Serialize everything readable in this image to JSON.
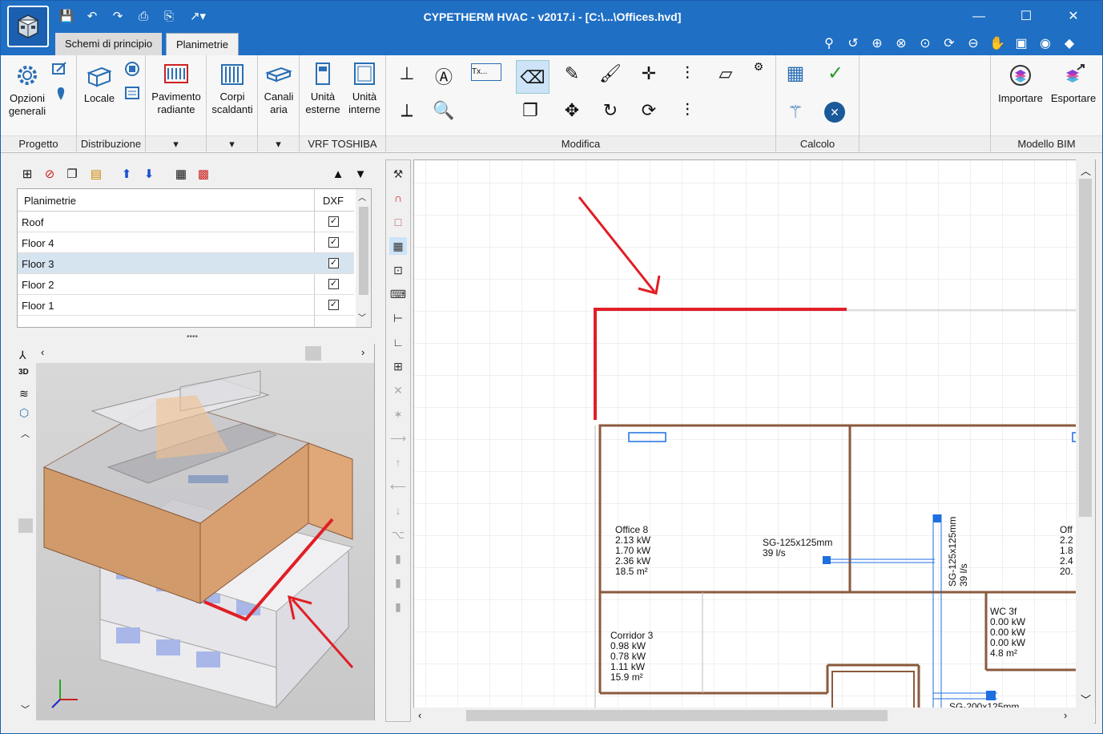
{
  "title": "CYPETHERM HVAC - v2017.i - [C:\\...\\Offices.hvd]",
  "tabs": [
    "Schemi di principio",
    "Planimetrie"
  ],
  "ribbon": {
    "opzioni": "Opzioni\ngenerali",
    "locale": "Locale",
    "pavimento": "Pavimento\nradiante",
    "corpi": "Corpi\nscaldanti",
    "canali": "Canali\naria",
    "esterne": "Unità\nesterne",
    "interne": "Unità\ninterne",
    "importare": "Importare",
    "esportare": "Esportare",
    "groups": {
      "progetto": "Progetto",
      "distribuzione": "Distribuzione",
      "vrf": "VRF TOSHIBA",
      "modifica": "Modifica",
      "calcolo": "Calcolo",
      "bim": "Modello BIM"
    }
  },
  "layers": {
    "col_name": "Planimetrie",
    "col_dxf": "DXF",
    "rows": [
      {
        "name": "Roof",
        "checked": true
      },
      {
        "name": "Floor 4",
        "checked": true
      },
      {
        "name": "Floor 3",
        "checked": true
      },
      {
        "name": "Floor 2",
        "checked": true
      },
      {
        "name": "Floor 1",
        "checked": true
      }
    ]
  },
  "drawing": {
    "office8": [
      "Office 8",
      "2.13 kW",
      "1.70 kW",
      "2.36 kW",
      "18.5 m²"
    ],
    "corridor3": [
      "Corridor 3",
      "0.98 kW",
      "0.78 kW",
      "1.11 kW",
      "15.9 m²"
    ],
    "wc3f": [
      "WC 3f",
      "0.00 kW",
      "0.00 kW",
      "0.00 kW",
      "4.8 m²"
    ],
    "off_partial": [
      "Off",
      "2.2",
      "1.8",
      "2.4",
      "20."
    ],
    "duct1": [
      "SG-125x125mm",
      "39 l/s"
    ],
    "duct2": [
      "SG-125x125mm",
      "39 l/s"
    ],
    "duct3": "SG-200x125mm"
  },
  "colors": {
    "titlebar": "#1f6fc4",
    "annotation": "#e01e26",
    "wall": "#8b5a3c",
    "duct": "#1e6fe0"
  }
}
